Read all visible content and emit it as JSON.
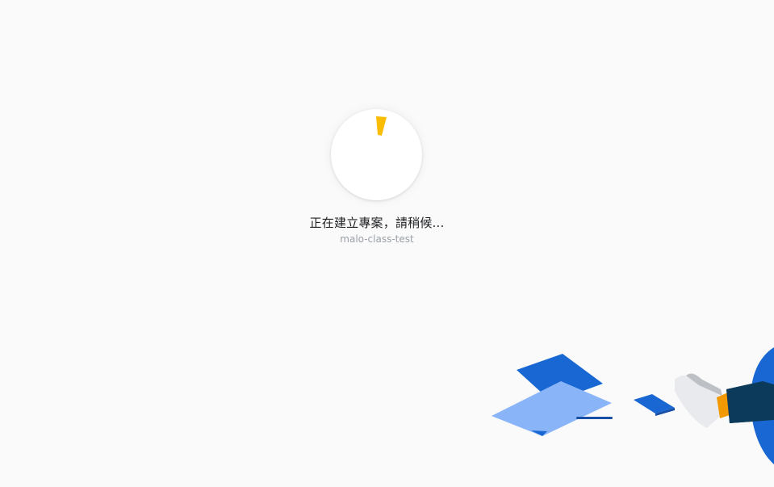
{
  "loader": {
    "status_text": "正在建立專案，請稍候...",
    "project_name": "malo-class-test"
  },
  "colors": {
    "background": "#fafafa",
    "spinner_accent": "#fbbc04",
    "illustration_blue": "#1967d2",
    "illustration_light_blue": "#8ab4f8",
    "illustration_navy": "#0b3a5b",
    "illustration_orange": "#f29900"
  }
}
